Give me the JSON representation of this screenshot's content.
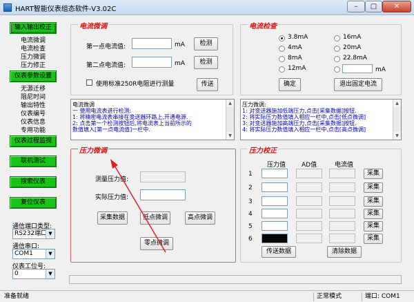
{
  "window": {
    "title": "HART智能仪表组态软件-V3.02C",
    "min": "–",
    "max": "□",
    "close": "✕"
  },
  "sidebar": {
    "btn_input_output": "输入输出校正",
    "group1": [
      "电流微调",
      "电流检查",
      "压力微调",
      "压力修正"
    ],
    "btn_param": "仪表参数设置",
    "group2": [
      "无源迁移",
      "阻尼时间",
      "输出特性",
      "仪表编号",
      "仪表信息",
      "专用功能"
    ],
    "btn_monitor": "仪表过程监视",
    "btn_online": "联机测试",
    "btn_search": "搜索仪表",
    "btn_reset": "复位仪表",
    "port_type_label": "通信端口类型:",
    "port_type_value": "RS232端口",
    "port_label": "通信串口:",
    "port_value": "COM1",
    "addr_label": "仪表工位号:",
    "addr_value": "0"
  },
  "current_trim": {
    "title": "电流微调",
    "row1_label": "第一点电流值:",
    "row1_unit": "mA",
    "row1_btn": "检测",
    "row2_label": "第二点电流值:",
    "row2_unit": "mA",
    "row2_btn": "检测",
    "checkbox_label": "使用标准250R电阻进行测量",
    "send_btn": "传送"
  },
  "current_check": {
    "title": "电流检查",
    "options": [
      "3.8mA",
      "4mA",
      "8mA",
      "12mA",
      "16mA",
      "20mA",
      "22.8mA",
      ""
    ],
    "custom_unit": "mA",
    "ok_btn": "确定",
    "exit_btn": "退出固定电流"
  },
  "memo_current": {
    "lines": [
      "电流微调",
      "一 使用电流表进行检测:",
      "  1: 将精密电流表串接在变送器环路上,开通电源.",
      "  2: 点击第一个检测按钮后,将电流表上当前所示的",
      "     数值填入[第一点电流值]一栏中."
    ]
  },
  "memo_pressure": {
    "lines": [
      "压力微调:",
      "1: 对变送器施加低端压力,点击[采集数据]按钮.",
      "2: 将实际压力数值填入相应一栏中,点击[低点微调]",
      "3: 对变送器施加高端压力,点击[采集数据]按钮.",
      "4: 将实际压力数值填入相应一栏中,点击[高点微调]"
    ]
  },
  "pressure_trim": {
    "title": "压力微调",
    "measured_label": "测量压力值:",
    "actual_label": "实际压力值:",
    "collect_btn": "采集数据",
    "low_btn": "低点微调",
    "high_btn": "高点微调",
    "zero_btn": "零点微调"
  },
  "pressure_cal": {
    "title": "压力校正",
    "col_pressure": "压力值",
    "col_ad": "AD值",
    "col_current": "电流值",
    "rows": [
      "1",
      "2",
      "3",
      "4",
      "5",
      "6"
    ],
    "collect_btn": "采集",
    "send_btn": "传送数据",
    "clear_btn": "清除数据"
  },
  "status": {
    "left": "准备就绪",
    "mode": "正常模式",
    "port": "端口: COM1"
  }
}
